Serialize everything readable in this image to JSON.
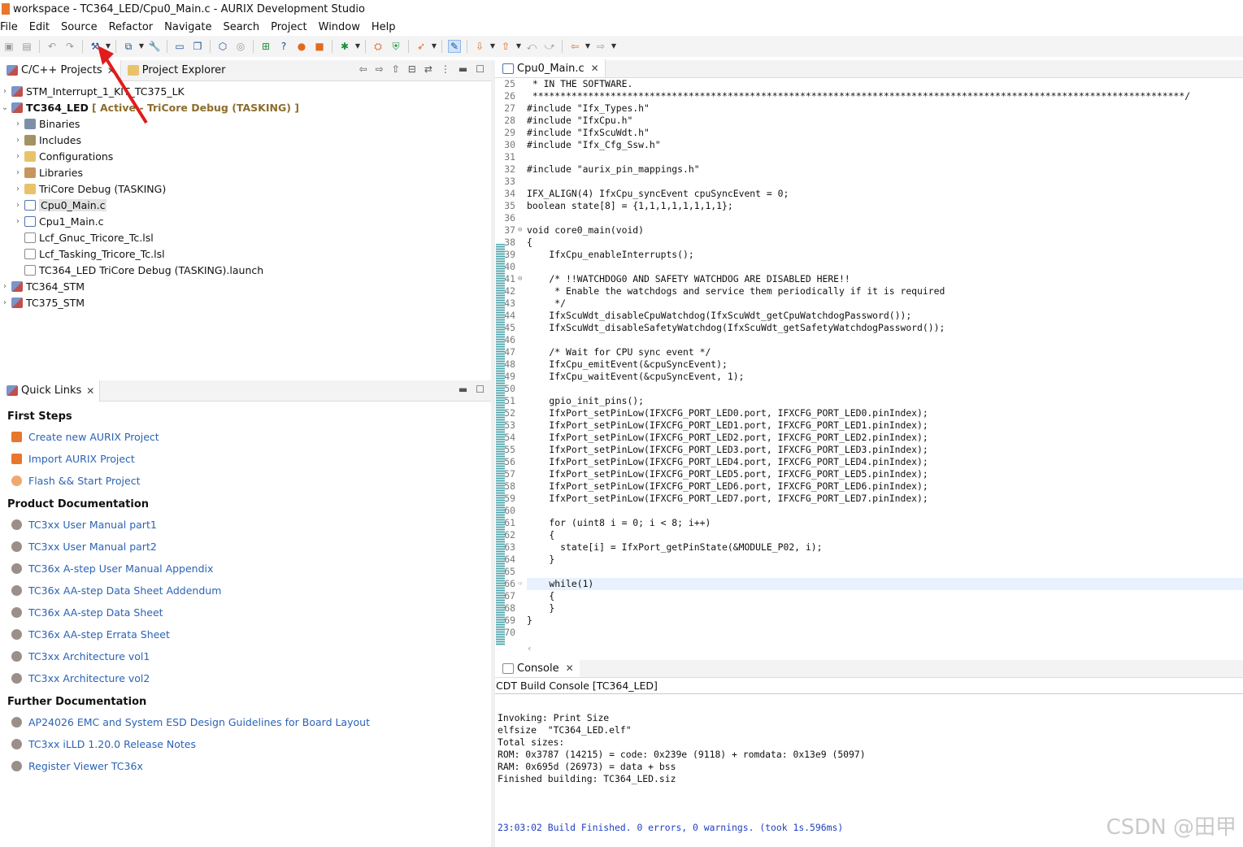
{
  "window": {
    "title": "workspace - TC364_LED/Cpu0_Main.c - AURIX Development Studio"
  },
  "menu": [
    "File",
    "Edit",
    "Source",
    "Refactor",
    "Navigate",
    "Search",
    "Project",
    "Window",
    "Help"
  ],
  "explorer": {
    "tabs": [
      {
        "label": "C/C++ Projects"
      },
      {
        "label": "Project Explorer"
      }
    ],
    "tree": [
      {
        "label": "STM_Interrupt_1_KIT_TC375_LK",
        "depth": 0,
        "icon": "project-icon",
        "twisty": "›"
      },
      {
        "label": "TC364_LED",
        "depth": 0,
        "icon": "project-icon",
        "twisty": "⌄",
        "bold": true,
        "tag": "[ Active - TriCore Debug (TASKING) ]"
      },
      {
        "label": "Binaries",
        "depth": 1,
        "icon": "binaries-icon",
        "twisty": "›"
      },
      {
        "label": "Includes",
        "depth": 1,
        "icon": "includes-icon",
        "twisty": "›"
      },
      {
        "label": "Configurations",
        "depth": 1,
        "icon": "folder-icon",
        "twisty": "›"
      },
      {
        "label": "Libraries",
        "depth": 1,
        "icon": "library-folder-icon",
        "twisty": "›"
      },
      {
        "label": "TriCore Debug (TASKING)",
        "depth": 1,
        "icon": "folder-icon",
        "twisty": "›"
      },
      {
        "label": "Cpu0_Main.c",
        "depth": 1,
        "icon": "c-file-icon",
        "twisty": "›",
        "selected": true
      },
      {
        "label": "Cpu1_Main.c",
        "depth": 1,
        "icon": "c-file-icon",
        "twisty": "›"
      },
      {
        "label": "Lcf_Gnuc_Tricore_Tc.lsl",
        "depth": 1,
        "icon": "file-icon",
        "twisty": ""
      },
      {
        "label": "Lcf_Tasking_Tricore_Tc.lsl",
        "depth": 1,
        "icon": "file-icon",
        "twisty": ""
      },
      {
        "label": "TC364_LED TriCore Debug (TASKING).launch",
        "depth": 1,
        "icon": "file-icon",
        "twisty": ""
      },
      {
        "label": "TC364_STM",
        "depth": 0,
        "icon": "project-icon",
        "twisty": "›"
      },
      {
        "label": "TC375_STM",
        "depth": 0,
        "icon": "project-icon",
        "twisty": "›"
      }
    ]
  },
  "quicklinks": {
    "tab": "Quick Links",
    "sections": [
      {
        "heading": "First Steps",
        "links": [
          {
            "label": "Create new AURIX Project",
            "icon": "og"
          },
          {
            "label": "Import AURIX Project",
            "icon": "og"
          },
          {
            "label": "Flash && Start Project",
            "icon": "ol"
          }
        ]
      },
      {
        "heading": "Product Documentation",
        "links": [
          {
            "label": "TC3xx User Manual part1",
            "icon": "gr"
          },
          {
            "label": "TC3xx User Manual part2",
            "icon": "gr"
          },
          {
            "label": "TC36x A-step User Manual Appendix",
            "icon": "gr"
          },
          {
            "label": "TC36x AA-step Data Sheet Addendum",
            "icon": "gr"
          },
          {
            "label": "TC36x AA-step Data Sheet",
            "icon": "gr"
          },
          {
            "label": "TC36x AA-step Errata Sheet",
            "icon": "gr"
          },
          {
            "label": "TC3xx Architecture vol1",
            "icon": "gr"
          },
          {
            "label": "TC3xx Architecture vol2",
            "icon": "gr"
          }
        ]
      },
      {
        "heading": "Further Documentation",
        "links": [
          {
            "label": "AP24026 EMC and System ESD Design Guidelines for Board Layout",
            "icon": "gr"
          },
          {
            "label": "TC3xx iLLD 1.20.0 Release Notes",
            "icon": "gr"
          },
          {
            "label": "Register Viewer TC36x",
            "icon": "gr"
          }
        ]
      }
    ]
  },
  "editor": {
    "tab": "Cpu0_Main.c",
    "lines": [
      {
        "n": "25",
        "t": " * IN THE SOFTWARE."
      },
      {
        "n": "26",
        "t": " *********************************************************************************************************************/"
      },
      {
        "n": "27",
        "t": "#include \"Ifx_Types.h\""
      },
      {
        "n": "28",
        "t": "#include \"IfxCpu.h\""
      },
      {
        "n": "29",
        "t": "#include \"IfxScuWdt.h\""
      },
      {
        "n": "30",
        "t": "#include \"Ifx_Cfg_Ssw.h\""
      },
      {
        "n": "31",
        "t": ""
      },
      {
        "n": "32",
        "t": "#include \"aurix_pin_mappings.h\""
      },
      {
        "n": "33",
        "t": ""
      },
      {
        "n": "34",
        "t": "IFX_ALIGN(4) IfxCpu_syncEvent cpuSyncEvent = 0;"
      },
      {
        "n": "35",
        "t": "boolean state[8] = {1,1,1,1,1,1,1,1};"
      },
      {
        "n": "36",
        "t": ""
      },
      {
        "n": "37",
        "t": "void core0_main(void)",
        "g": "⊖"
      },
      {
        "n": "38",
        "t": "{"
      },
      {
        "n": "39",
        "t": "    IfxCpu_enableInterrupts();"
      },
      {
        "n": "40",
        "t": ""
      },
      {
        "n": "41",
        "t": "    /* !!WATCHDOG0 AND SAFETY WATCHDOG ARE DISABLED HERE!!",
        "g": "⊖"
      },
      {
        "n": "42",
        "t": "     * Enable the watchdogs and service them periodically if it is required"
      },
      {
        "n": "43",
        "t": "     */"
      },
      {
        "n": "44",
        "t": "    IfxScuWdt_disableCpuWatchdog(IfxScuWdt_getCpuWatchdogPassword());"
      },
      {
        "n": "45",
        "t": "    IfxScuWdt_disableSafetyWatchdog(IfxScuWdt_getSafetyWatchdogPassword());"
      },
      {
        "n": "46",
        "t": ""
      },
      {
        "n": "47",
        "t": "    /* Wait for CPU sync event */"
      },
      {
        "n": "48",
        "t": "    IfxCpu_emitEvent(&cpuSyncEvent);"
      },
      {
        "n": "49",
        "t": "    IfxCpu_waitEvent(&cpuSyncEvent, 1);"
      },
      {
        "n": "50",
        "t": ""
      },
      {
        "n": "51",
        "t": "    gpio_init_pins();"
      },
      {
        "n": "52",
        "t": "    IfxPort_setPinLow(IFXCFG_PORT_LED0.port, IFXCFG_PORT_LED0.pinIndex);"
      },
      {
        "n": "53",
        "t": "    IfxPort_setPinLow(IFXCFG_PORT_LED1.port, IFXCFG_PORT_LED1.pinIndex);"
      },
      {
        "n": "54",
        "t": "    IfxPort_setPinLow(IFXCFG_PORT_LED2.port, IFXCFG_PORT_LED2.pinIndex);"
      },
      {
        "n": "55",
        "t": "    IfxPort_setPinLow(IFXCFG_PORT_LED3.port, IFXCFG_PORT_LED3.pinIndex);"
      },
      {
        "n": "56",
        "t": "    IfxPort_setPinLow(IFXCFG_PORT_LED4.port, IFXCFG_PORT_LED4.pinIndex);"
      },
      {
        "n": "57",
        "t": "    IfxPort_setPinLow(IFXCFG_PORT_LED5.port, IFXCFG_PORT_LED5.pinIndex);"
      },
      {
        "n": "58",
        "t": "    IfxPort_setPinLow(IFXCFG_PORT_LED6.port, IFXCFG_PORT_LED6.pinIndex);"
      },
      {
        "n": "59",
        "t": "    IfxPort_setPinLow(IFXCFG_PORT_LED7.port, IFXCFG_PORT_LED7.pinIndex);"
      },
      {
        "n": "60",
        "t": ""
      },
      {
        "n": "61",
        "t": "    for (uint8 i = 0; i < 8; i++)"
      },
      {
        "n": "62",
        "t": "    {"
      },
      {
        "n": "63",
        "t": "      state[i] = IfxPort_getPinState(&MODULE_P02, i);"
      },
      {
        "n": "64",
        "t": "    }"
      },
      {
        "n": "65",
        "t": ""
      },
      {
        "n": "66",
        "t": "    while(1)",
        "hl": true,
        "g": "⇨"
      },
      {
        "n": "67",
        "t": "    {"
      },
      {
        "n": "68",
        "t": "    }"
      },
      {
        "n": "69",
        "t": "}"
      },
      {
        "n": "70",
        "t": ""
      }
    ]
  },
  "console": {
    "tab": "Console",
    "title": "CDT Build Console [TC364_LED]",
    "lines": [
      {
        "t": "Invoking: Print Size"
      },
      {
        "t": "elfsize  \"TC364_LED.elf\""
      },
      {
        "t": "Total sizes:"
      },
      {
        "t": "ROM: 0x3787 (14215) = code: 0x239e (9118) + romdata: 0x13e9 (5097)"
      },
      {
        "t": "RAM: 0x695d (26973) = data + bss"
      },
      {
        "t": "Finished building: TC364_LED.siz"
      },
      {
        "t": ""
      },
      {
        "t": ""
      },
      {
        "t": ""
      },
      {
        "t": "23:03:02 Build Finished. 0 errors, 0 warnings. (took 1s.596ms)",
        "blue": true
      }
    ]
  },
  "watermark": "CSDN @田甲"
}
